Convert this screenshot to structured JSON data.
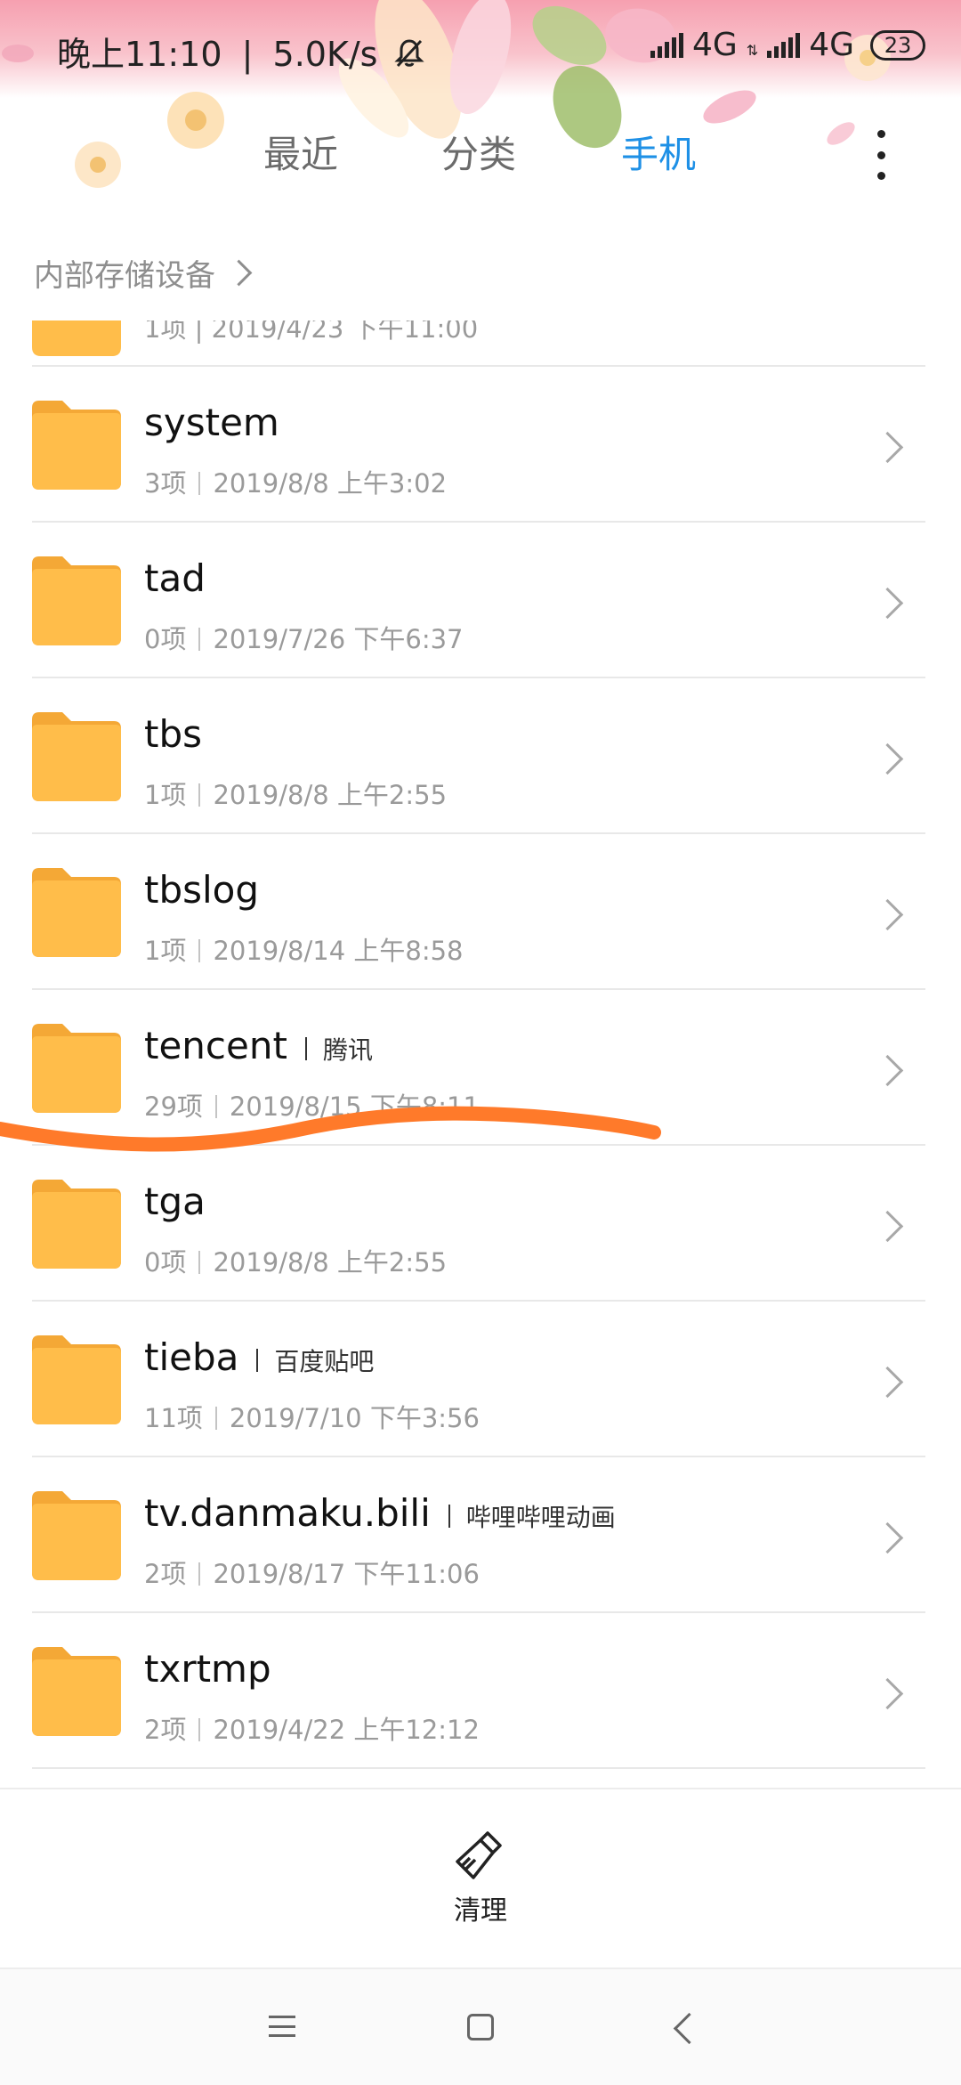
{
  "status_bar": {
    "time": "晚上11:10",
    "separator": "|",
    "network_speed": "5.0K/s",
    "sim1_label": "4G",
    "sim2_label": "4G",
    "battery": "23"
  },
  "tabs": [
    {
      "label": "最近",
      "active": false
    },
    {
      "label": "分类",
      "active": false
    },
    {
      "label": "手机",
      "active": true
    }
  ],
  "breadcrumb": {
    "label": "内部存储设备"
  },
  "partial_item": {
    "meta": "1项  |  2019/4/23 下午11:00"
  },
  "folders": [
    {
      "name": "system",
      "alias": "",
      "count": "3项",
      "date": "2019/8/8 上午3:02"
    },
    {
      "name": "tad",
      "alias": "",
      "count": "0项",
      "date": "2019/7/26 下午6:37"
    },
    {
      "name": "tbs",
      "alias": "",
      "count": "1项",
      "date": "2019/8/8 上午2:55"
    },
    {
      "name": "tbslog",
      "alias": "",
      "count": "1项",
      "date": "2019/8/14 上午8:58"
    },
    {
      "name": "tencent",
      "alias": "腾讯",
      "count": "29项",
      "date": "2019/8/15 下午8:11"
    },
    {
      "name": "tga",
      "alias": "",
      "count": "0项",
      "date": "2019/8/8 上午2:55"
    },
    {
      "name": "tieba",
      "alias": "百度贴吧",
      "count": "11项",
      "date": "2019/7/10 下午3:56"
    },
    {
      "name": "tv.danmaku.bili",
      "alias": "哔哩哔哩动画",
      "count": "2项",
      "date": "2019/8/17 下午11:06"
    },
    {
      "name": "txrtmp",
      "alias": "",
      "count": "2项",
      "date": "2019/4/22 上午12:12"
    }
  ],
  "bottom_action": {
    "label": "清理",
    "icon": "broom-icon"
  },
  "colors": {
    "accent": "#1e90e6",
    "folder": "#ffbd4a",
    "folder_tab": "#f4a836",
    "annotation_stroke": "#ff7a2a"
  }
}
